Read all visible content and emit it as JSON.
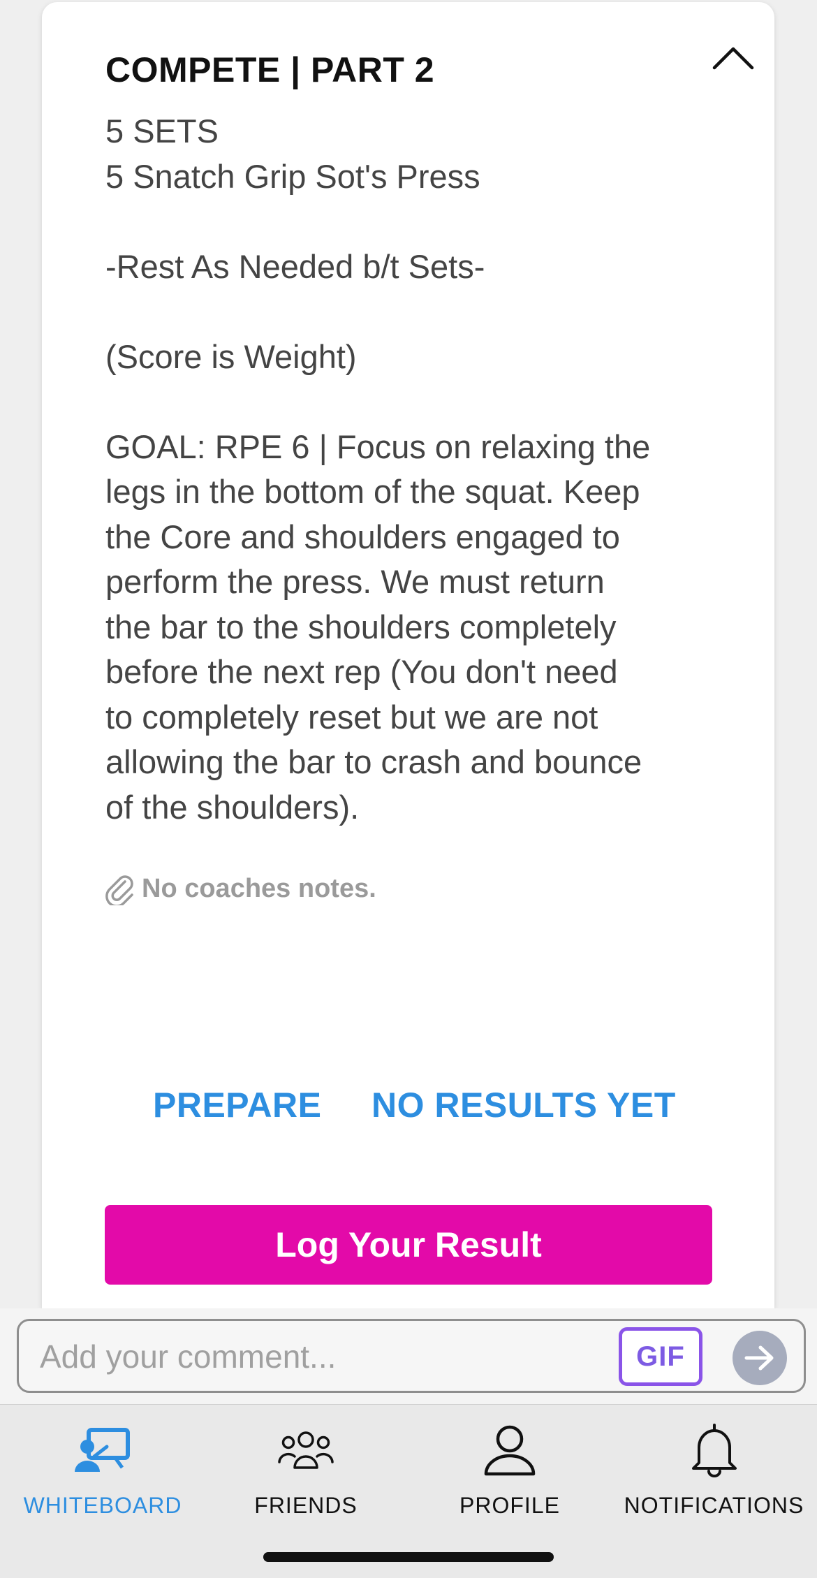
{
  "workout": {
    "title": "COMPETE | PART 2",
    "description": [
      "5 SETS",
      "5 Snatch Grip Sot's Press",
      "",
      "-Rest As Needed b/t Sets-",
      "",
      "(Score is Weight)",
      "",
      "GOAL: RPE 6 | Focus on relaxing the",
      "legs in the bottom of the squat. Keep",
      "the Core and shoulders engaged to",
      "perform the press. We must return",
      "the bar to the shoulders completely",
      "before the next rep (You don't need",
      "to completely reset but we are not",
      "allowing the bar to crash and bounce",
      "of the shoulders)."
    ],
    "coach_notes": "No coaches notes.",
    "prepare_label": "PREPARE",
    "results_label": "NO RESULTS YET",
    "log_button_label": "Log Your Result"
  },
  "comment": {
    "placeholder": "Add your comment...",
    "gif_label": "GIF"
  },
  "tabbar": {
    "tabs": [
      {
        "label": "WHITEBOARD",
        "icon": "whiteboard-icon",
        "active": true
      },
      {
        "label": "FRIENDS",
        "icon": "friends-icon",
        "active": false
      },
      {
        "label": "PROFILE",
        "icon": "profile-icon",
        "active": false
      },
      {
        "label": "NOTIFICATIONS",
        "icon": "bell-icon",
        "active": false
      }
    ]
  },
  "colors": {
    "accent_blue": "#2d8ee0",
    "log_button": "#e30aa9",
    "gif_border": "#8a54e8",
    "send_button": "#a6acbd"
  }
}
